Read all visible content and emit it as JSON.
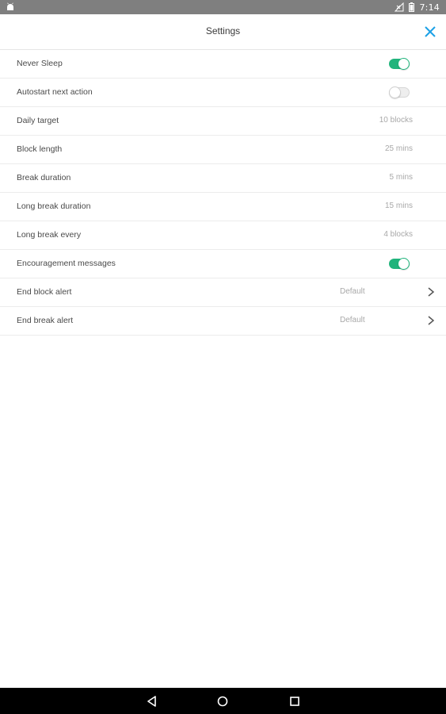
{
  "status_bar": {
    "time": "7:14",
    "icons": [
      "android-icon",
      "no-signal-icon",
      "battery-icon"
    ]
  },
  "header": {
    "title": "Settings",
    "close_icon": "close-icon"
  },
  "colors": {
    "accent": "#1da1e6",
    "toggle_on": "#21b47c",
    "status_bar": "#7f7f7f",
    "nav_bar": "#000000"
  },
  "settings": [
    {
      "label": "Never Sleep",
      "type": "toggle",
      "on": true
    },
    {
      "label": "Autostart next action",
      "type": "toggle",
      "on": false
    },
    {
      "label": "Daily target",
      "type": "value",
      "value": "10 blocks"
    },
    {
      "label": "Block length",
      "type": "value",
      "value": "25 mins"
    },
    {
      "label": "Break duration",
      "type": "value",
      "value": "5 mins"
    },
    {
      "label": "Long break duration",
      "type": "value",
      "value": "15 mins"
    },
    {
      "label": "Long break every",
      "type": "value",
      "value": "4 blocks"
    },
    {
      "label": "Encouragement messages",
      "type": "toggle",
      "on": true
    },
    {
      "label": "End block alert",
      "type": "link",
      "value": "Default"
    },
    {
      "label": "End break alert",
      "type": "link",
      "value": "Default"
    }
  ],
  "nav_bar": {
    "buttons": [
      "back-icon",
      "home-icon",
      "recents-icon"
    ]
  }
}
